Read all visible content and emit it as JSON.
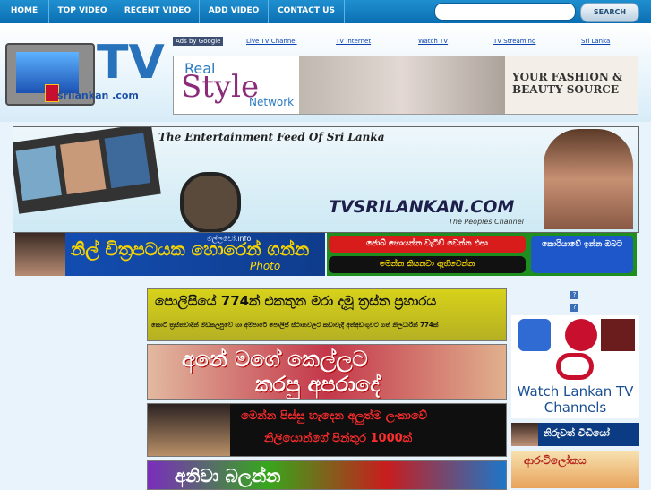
{
  "nav": {
    "items": [
      "HOME",
      "TOP VIDEO",
      "RECENT VIDEO",
      "ADD VIDEO",
      "CONTACT US"
    ],
    "search_label": "SEARCH"
  },
  "logo": {
    "tv": "TV",
    "site": "srilankan .com"
  },
  "ads_by_google": "Ads by Google",
  "ad_links": [
    "Live TV Channel",
    "TV Internet",
    "Watch TV",
    "TV Streaming",
    "Sri Lanka"
  ],
  "ad_banner": {
    "real": "Real",
    "style": "Style",
    "network": "Network",
    "line1": "YOUR FASHION &",
    "line2": "BEAUTY SOURCE"
  },
  "feed": {
    "title": "The Entertainment Feed Of Sri Lanka",
    "site": "TVSRILANKAN.COM",
    "tagline": "The Peoples Channel"
  },
  "promo": {
    "left_text": "නිල් චිත්‍රපටයක හොරෙන් ගන්න",
    "info": "මල්ලවෝ.info",
    "photo": "Photo",
    "right_top_left": "ජොබ් හොයන්න වැටිච් වෙන්න එපා",
    "right_bottom_left": "මෙන්න කියනවා ඇහිවෙන්න",
    "right_box": "කොරියාවේ ඉන්න ඔබට"
  },
  "content_ads": [
    {
      "line1": "පොලිසියේ 774ක් එකතුන මරා දමූ ත්‍රස්ත ප්‍රහාරය",
      "line2": "කොටි ත්‍රස්තවාදීන් මඩකලපුවේ හා අම්පාරේ පොලිස් ස්ථානවලට කඩාවැදී අත්අඩංගුවට ගත් නිලධාරීන් 774ක්"
    },
    {
      "line1": "අනේ මගේ කෙල්ලට",
      "line2": "කරපු අපරාදේ"
    },
    {
      "line1": "මෙන්න පිස්සු හැදෙන අලුත්ම ලංකාවේ",
      "line2": "නිලියොන්ගේ පින්තූර 1000ක්"
    },
    {
      "line1": "අනිවා බලන්න",
      "line2": ""
    }
  ],
  "side": {
    "watch": "Watch Lankan TV Channels",
    "strip": "නිරුවත් වීඩියෝ",
    "bottom": "ආරංචිලෝකය"
  }
}
